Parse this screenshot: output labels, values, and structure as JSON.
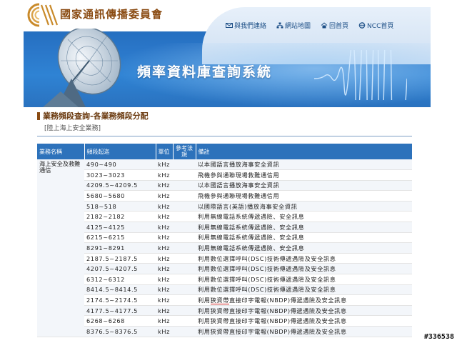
{
  "org_name": "國家通訊傳播委員會",
  "top_nav": [
    {
      "label": "與我們連絡",
      "icon": "envelope-icon"
    },
    {
      "label": "網站地圖",
      "icon": "sitemap-icon"
    },
    {
      "label": "回首頁",
      "icon": "home-icon"
    },
    {
      "label": "NCC首頁",
      "icon": "globe-icon"
    }
  ],
  "banner_title": "頻率資料庫查詢系統",
  "page": {
    "title": "業務頻段查詢-各業務頻段分配",
    "subtitle": "[陸上海上安全業務]"
  },
  "table": {
    "headers": [
      "業務名稱",
      "頻段起迄",
      "單位",
      "參考法規",
      "備註"
    ],
    "service_name": "海上安全及救難通信",
    "rows": [
      {
        "range": "490~490",
        "unit": "kHz",
        "ref": "",
        "note": "以本國語言播放海事安全資訊"
      },
      {
        "range": "3023~3023",
        "unit": "kHz",
        "ref": "",
        "note": "飛機參與通聯現場救難通信用"
      },
      {
        "range": "4209.5~4209.5",
        "unit": "kHz",
        "ref": "",
        "note": "以本國語言播放海事安全資訊"
      },
      {
        "range": "5680~5680",
        "unit": "kHz",
        "ref": "",
        "note": "飛機參與通聯現場救難通信用"
      },
      {
        "range": "518~518",
        "unit": "kHz",
        "ref": "",
        "note": "以國際語言(英語)播放海事安全資訊"
      },
      {
        "range": "2182~2182",
        "unit": "kHz",
        "ref": "",
        "note": "利用無線電話系統傳遞遇險、安全訊息"
      },
      {
        "range": "4125~4125",
        "unit": "kHz",
        "ref": "",
        "note": "利用無線電話系統傳遞遇險、安全訊息"
      },
      {
        "range": "6215~6215",
        "unit": "kHz",
        "ref": "",
        "note": "利用無線電話系統傳遞遇險、安全訊息"
      },
      {
        "range": "8291~8291",
        "unit": "kHz",
        "ref": "",
        "note": "利用無線電話系統傳遞遇險、安全訊息"
      },
      {
        "range": "2187.5~2187.5",
        "unit": "kHz",
        "ref": "",
        "note": "利用數位選擇呼叫(DSC)技術傳遞遇險及安全訊息"
      },
      {
        "range": "4207.5~4207.5",
        "unit": "kHz",
        "ref": "",
        "note": "利用數位選擇呼叫(DSC)技術傳遞遇險及安全訊息"
      },
      {
        "range": "6312~6312",
        "unit": "kHz",
        "ref": "",
        "note": "利用數位選擇呼叫(DSC)技術傳遞遇險及安全訊息"
      },
      {
        "range": "8414.5~8414.5",
        "unit": "kHz",
        "ref": "",
        "note": "利用數位選擇呼叫(DSC)技術傳遞遇險及安全訊息"
      },
      {
        "range": "2174.5~2174.5",
        "unit": "kHz",
        "ref": "",
        "note_pre": "利用",
        "note_mark": "狹資帶",
        "note_post": "直接印字電報(NBDP)傳遞遇險及安全訊息"
      },
      {
        "range": "4177.5~4177.5",
        "unit": "kHz",
        "ref": "",
        "note": "利用狹資帶直接印字電報(NBDP)傳遞遇險及安全訊息"
      },
      {
        "range": "6268~6268",
        "unit": "kHz",
        "ref": "",
        "note": "利用狹資帶直接印字電報(NBDP)傳遞遇險及安全訊息"
      },
      {
        "range": "8376.5~8376.5",
        "unit": "kHz",
        "ref": "",
        "note": "利用狹資帶直接印字電報(NBDP)傳遞遇險及安全訊息"
      }
    ]
  },
  "watermark": "#336538",
  "colors": {
    "header_blue": "#2d72bb",
    "brand_brown": "#8a4b12",
    "underline_red": "#d02020"
  }
}
